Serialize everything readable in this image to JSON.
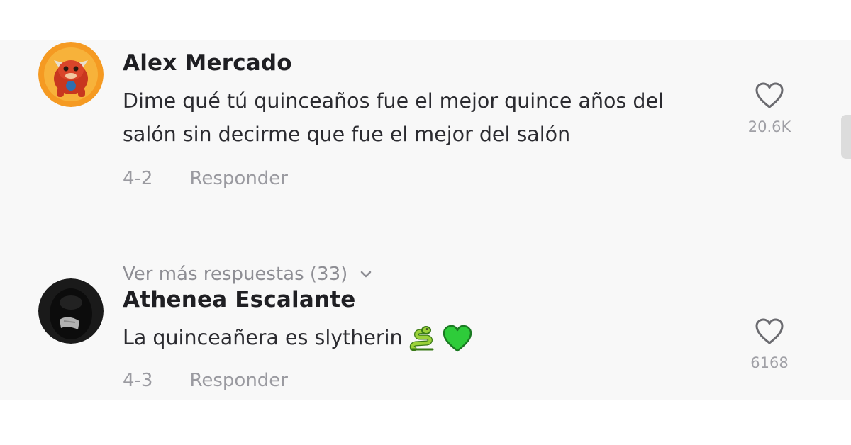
{
  "comments": [
    {
      "username": "Alex Mercado",
      "text_lines": [
        "Dime qué tú quinceaños fue el mejor quince años del",
        "salón sin decirme que fue el mejor del salón"
      ],
      "date": "4-2",
      "reply_label": "Responder",
      "likes": "20.6K"
    },
    {
      "username": "Athenea Escalante",
      "text_lines": [
        "La quinceañera es slytherin"
      ],
      "emojis": [
        "snake-icon",
        "green-heart-icon"
      ],
      "date": "4-3",
      "reply_label": "Responder",
      "likes": "6168"
    }
  ],
  "more_replies": "Ver más respuestas (33)",
  "colors": {
    "panel_bg": "#f8f8f8",
    "username": "#1f1f23",
    "secondary_text": "#9a9aa0",
    "heart_outline": "#6b6b70",
    "emoji_green": "#2ecc3a"
  }
}
